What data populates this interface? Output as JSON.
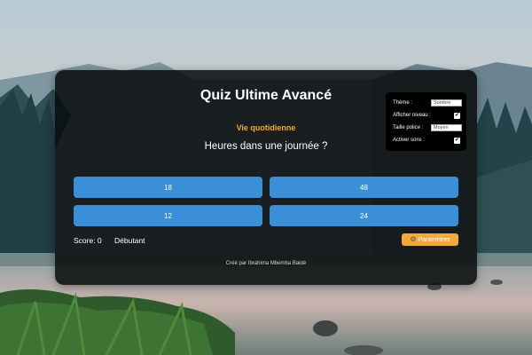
{
  "quiz": {
    "title": "Quiz Ultime Avancé",
    "category": "Vie quotidienne",
    "question": "Heures dans une journée ?",
    "answers": [
      "18",
      "48",
      "12",
      "24"
    ]
  },
  "status": {
    "score_label": "Score: 0",
    "level": "Débutant"
  },
  "params_button": {
    "label": "Paramètres",
    "icon": "gear-icon"
  },
  "footer": {
    "credit": "Créé par Ibrahima Mbemba Baldé"
  },
  "settings": {
    "theme_label": "Thème :",
    "theme_value": "Sombre",
    "show_level_label": "Afficher niveau :",
    "show_level_checked": true,
    "font_size_label": "Taille police :",
    "font_size_value": "Moyen",
    "sound_label": "Activer sons :",
    "sound_checked": true
  },
  "colors": {
    "accent_orange": "#f0a93a",
    "answer_blue": "#3a8fd8",
    "card_bg": "#0a0c0e"
  }
}
